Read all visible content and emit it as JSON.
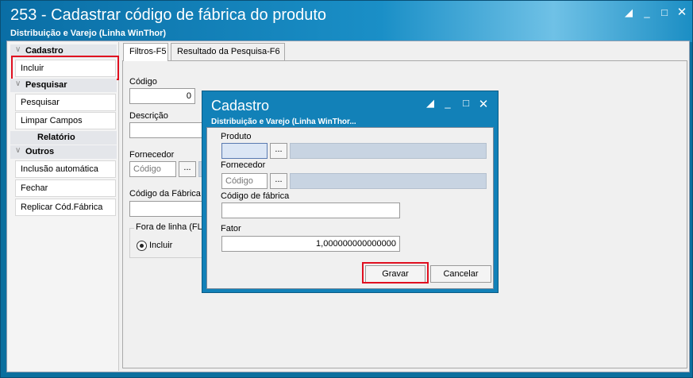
{
  "window": {
    "title": "253 - Cadastrar código de fábrica do produto",
    "subtitle": "Distribuição e Varejo (Linha WinThor)",
    "controls": [
      "restore-icon",
      "minimize-icon",
      "maximize-icon",
      "close-icon"
    ]
  },
  "sidebar": {
    "cadastro": {
      "title": "Cadastro",
      "items": [
        "Incluir"
      ]
    },
    "pesquisar": {
      "title": "Pesquisar",
      "items": [
        "Pesquisar",
        "Limpar Campos"
      ]
    },
    "relatorio": {
      "title": "Relatório"
    },
    "outros": {
      "title": "Outros",
      "items": [
        "Inclusão automática",
        "Fechar",
        "Replicar Cód.Fábrica"
      ]
    }
  },
  "tabs": [
    "Filtros-F5",
    "Resultado da Pesquisa-F6"
  ],
  "filters": {
    "codigo_label": "Código",
    "codigo_value": "0",
    "descricao_label": "Descrição",
    "fornecedor_label": "Fornecedor",
    "fornecedor_placeholder": "Código",
    "fornecedor_btn": "...",
    "codfab_label": "Código da Fábrica",
    "foralinha_label": "Fora de linha (FL)",
    "radio_incluir": "Incluir"
  },
  "modal": {
    "title": "Cadastro",
    "subtitle": "Distribuição e Varejo (Linha WinThor...",
    "produto_label": "Produto",
    "produto_btn": "...",
    "fornecedor_label": "Fornecedor",
    "fornecedor_placeholder": "Código",
    "fornecedor_btn": "...",
    "codfab_label": "Código de fábrica",
    "fator_label": "Fator",
    "fator_value": "1,000000000000000",
    "gravar": "Gravar",
    "cancelar": "Cancelar"
  },
  "colors": {
    "titlebar": "#1281b8",
    "highlight": "#e01020"
  }
}
